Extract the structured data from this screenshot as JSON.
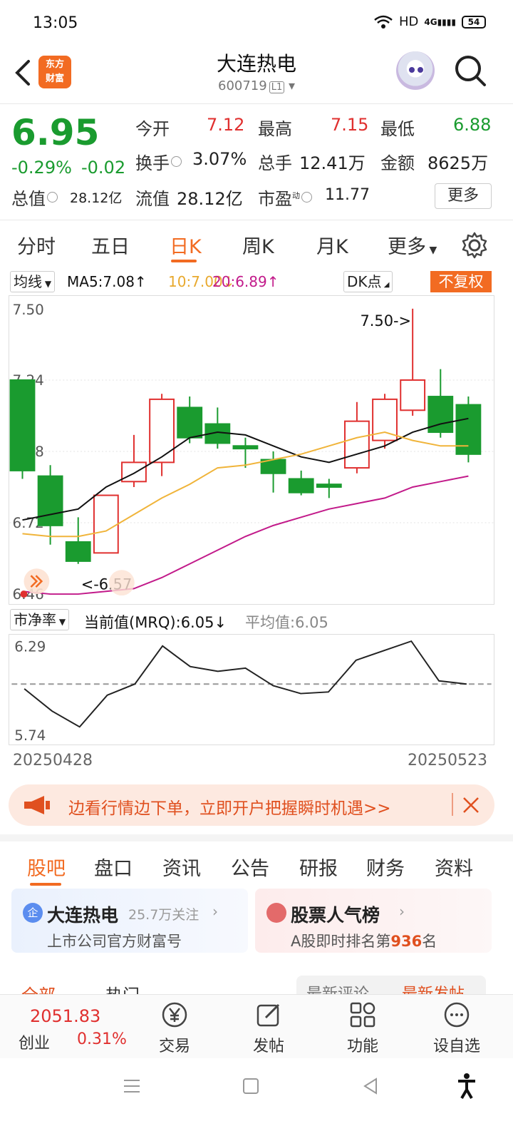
{
  "status": {
    "time": "13:05",
    "network": "HD",
    "signal": "4G",
    "battery": "54"
  },
  "header": {
    "title": "大连热电",
    "code": "600719",
    "level_badge": "L1",
    "logo_text_1": "东方",
    "logo_text_2": "财富"
  },
  "quote": {
    "price": "6.95",
    "change_pct": "-0.29%",
    "change": "-0.02",
    "open_label": "今开",
    "open": "7.12",
    "high_label": "最高",
    "high": "7.15",
    "low_label": "最低",
    "low": "6.88",
    "turnover_label": "换手",
    "turnover": "3.07%",
    "volume_label": "总手",
    "volume": "12.41万",
    "amount_label": "金额",
    "amount": "8625万",
    "mktcap_label": "总值",
    "mktcap": "28.12亿",
    "float_label": "流值",
    "float": "28.12亿",
    "pe_label": "市盈",
    "pe_sup": "动",
    "pe": "11.77",
    "more_label": "更多"
  },
  "tabs": [
    "分时",
    "五日",
    "日K",
    "周K",
    "月K",
    "更多"
  ],
  "ma_row": {
    "selector": "均线",
    "ma5": "MA5:7.08↑",
    "ma10": "10:7.00↓",
    "ma20": "20:6.89↑",
    "dk": "DK点",
    "adjust": "不复权"
  },
  "chart_labels": {
    "max_marker": "7.50->",
    "min_marker": "<-6.57"
  },
  "indicator": {
    "selector": "市净率",
    "current": "当前值(MRQ):6.05↓",
    "avg": "平均值:6.05",
    "y_top": "6.29",
    "y_bottom": "5.74"
  },
  "dates": {
    "start": "20250428",
    "end": "20250523"
  },
  "banner": {
    "text": "边看行情边下单，立即开户把握瞬时机遇>>"
  },
  "subtabs": [
    "股吧",
    "盘口",
    "资讯",
    "公告",
    "研报",
    "财务",
    "资料"
  ],
  "cards": {
    "left_title": "大连热电",
    "left_follow": "25.7万关注",
    "left_sub": "上市公司官方财富号",
    "left_badge": "企",
    "right_title": "股票人气榜",
    "right_sub_prefix": "A股即时排名第",
    "right_rank": "936",
    "right_sub_suffix": "名"
  },
  "filters": {
    "all": "全部",
    "hot": "热门",
    "latest_comment": "最新评论",
    "latest_post": "最新发帖"
  },
  "bottom_nav": {
    "index_value": "2051.83",
    "index_name": "创业",
    "index_change": "0.31%",
    "trade": "交易",
    "post": "发帖",
    "functions": "功能",
    "watchlist": "设自选"
  },
  "colors": {
    "up": "#e0302f",
    "down": "#1a9b2f",
    "accent": "#f26b22",
    "ma5": "#111111",
    "ma10": "#f0b43a",
    "ma20": "#c21a8a"
  },
  "chart_data": [
    {
      "type": "candlestick",
      "title": "",
      "y_ticks": [
        "7.50",
        "7.24",
        "6.98",
        "6.72",
        "6.46"
      ],
      "ylim": [
        6.46,
        7.5
      ],
      "candles": [
        {
          "o": 7.24,
          "c": 6.91,
          "h": 7.24,
          "l": 6.88
        },
        {
          "o": 6.89,
          "c": 6.71,
          "h": 6.93,
          "l": 6.64
        },
        {
          "o": 6.65,
          "c": 6.58,
          "h": 6.74,
          "l": 6.57
        },
        {
          "o": 6.61,
          "c": 6.82,
          "h": 6.82,
          "l": 6.61
        },
        {
          "o": 6.87,
          "c": 6.94,
          "h": 7.04,
          "l": 6.85
        },
        {
          "o": 6.94,
          "c": 7.17,
          "h": 7.19,
          "l": 6.89
        },
        {
          "o": 7.14,
          "c": 7.03,
          "h": 7.18,
          "l": 7.01
        },
        {
          "o": 7.08,
          "c": 7.01,
          "h": 7.14,
          "l": 6.99
        },
        {
          "o": 7.0,
          "c": 6.99,
          "h": 7.03,
          "l": 6.92
        },
        {
          "o": 6.95,
          "c": 6.9,
          "h": 6.98,
          "l": 6.83
        },
        {
          "o": 6.88,
          "c": 6.83,
          "h": 6.91,
          "l": 6.82
        },
        {
          "o": 6.86,
          "c": 6.85,
          "h": 6.88,
          "l": 6.81
        },
        {
          "o": 6.92,
          "c": 7.09,
          "h": 7.16,
          "l": 6.9
        },
        {
          "o": 7.02,
          "c": 7.17,
          "h": 7.19,
          "l": 6.99
        },
        {
          "o": 7.13,
          "c": 7.24,
          "h": 7.5,
          "l": 7.11
        },
        {
          "o": 7.18,
          "c": 7.05,
          "h": 7.28,
          "l": 7.03
        },
        {
          "o": 7.15,
          "c": 6.97,
          "h": 7.18,
          "l": 6.94
        }
      ],
      "series": [
        {
          "name": "MA5",
          "values": [
            6.73,
            6.75,
            6.77,
            6.85,
            6.9,
            6.96,
            7.03,
            7.05,
            7.04,
            7.0,
            6.96,
            6.94,
            6.97,
            7.0,
            7.05,
            7.08,
            7.1
          ]
        },
        {
          "name": "MA10",
          "values": [
            6.68,
            6.67,
            6.67,
            6.69,
            6.75,
            6.81,
            6.86,
            6.92,
            6.93,
            6.95,
            6.97,
            7.0,
            7.03,
            7.05,
            7.02,
            7.0,
            7.0
          ]
        },
        {
          "name": "MA20",
          "values": [
            6.47,
            6.46,
            6.46,
            6.47,
            6.48,
            6.52,
            6.57,
            6.62,
            6.67,
            6.71,
            6.74,
            6.77,
            6.79,
            6.81,
            6.85,
            6.87,
            6.89
          ]
        }
      ]
    },
    {
      "type": "line",
      "title": "",
      "ylim": [
        5.74,
        6.29
      ],
      "avg": 6.05,
      "series": [
        {
          "name": "市净率",
          "values": [
            6.02,
            5.88,
            5.78,
            5.98,
            6.05,
            6.29,
            6.16,
            6.13,
            6.15,
            6.04,
            5.99,
            6.0,
            6.2,
            6.26,
            6.32,
            6.07,
            6.05
          ]
        }
      ]
    }
  ]
}
